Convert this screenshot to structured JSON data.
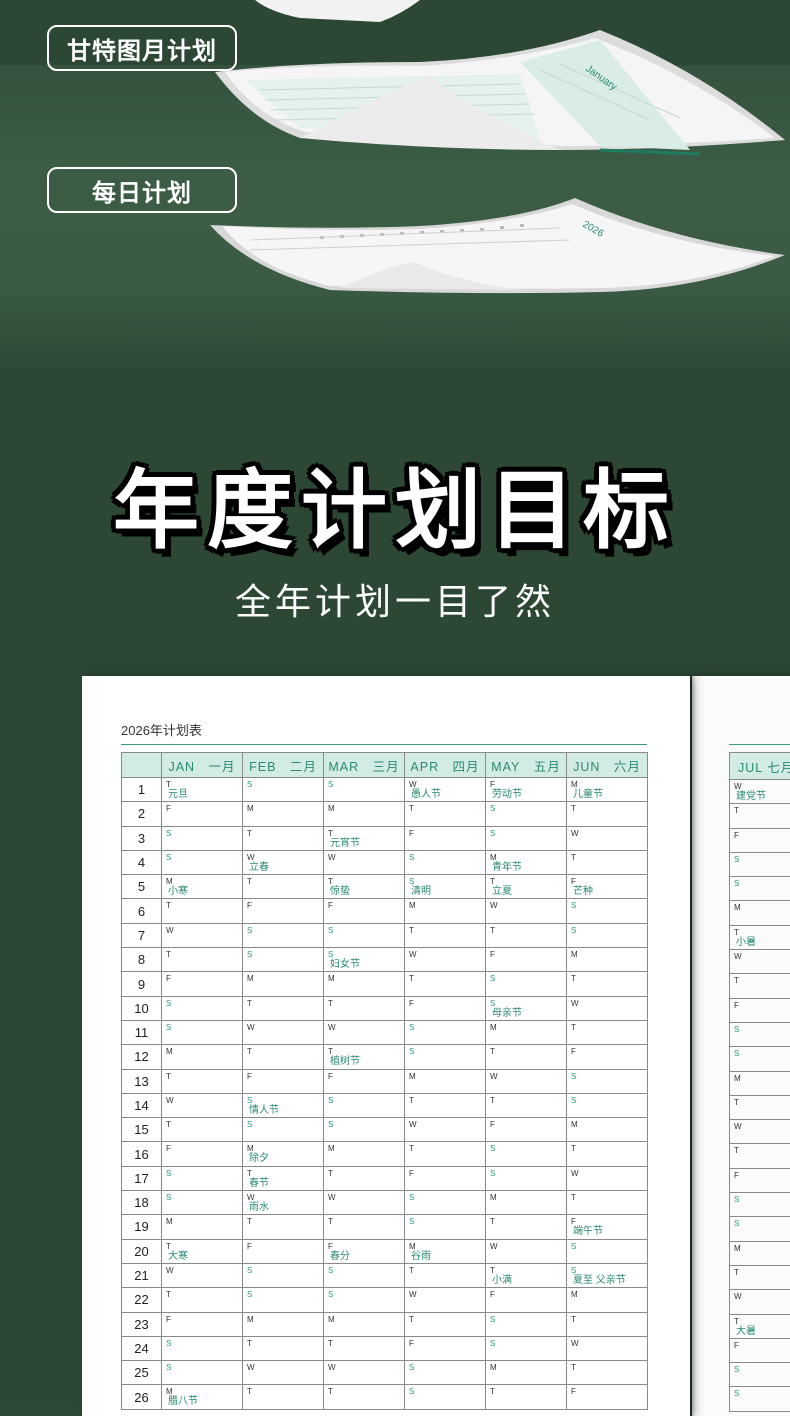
{
  "hero": {
    "gantt_label": "甘特图月计划",
    "daily_label": "每日计划",
    "sheet_month_label": "January",
    "sheet_year_label": "2026"
  },
  "section": {
    "title": "年度计划目标",
    "subtitle": "全年计划一目了然"
  },
  "sheet": {
    "heading": "2026年计划表",
    "months": [
      {
        "en": "JAN",
        "cn": "一月"
      },
      {
        "en": "FEB",
        "cn": "二月"
      },
      {
        "en": "MAR",
        "cn": "三月"
      },
      {
        "en": "APR",
        "cn": "四月"
      },
      {
        "en": "MAY",
        "cn": "五月"
      },
      {
        "en": "JUN",
        "cn": "六月"
      }
    ],
    "rows": [
      {
        "day": "1",
        "cells": [
          [
            "T",
            "元旦"
          ],
          [
            "S",
            ""
          ],
          [
            "S",
            ""
          ],
          [
            "W",
            "愚人节"
          ],
          [
            "F",
            "劳动节"
          ],
          [
            "M",
            "儿童节"
          ]
        ]
      },
      {
        "day": "2",
        "cells": [
          [
            "F",
            ""
          ],
          [
            "M",
            ""
          ],
          [
            "M",
            ""
          ],
          [
            "T",
            ""
          ],
          [
            "S",
            ""
          ],
          [
            "T",
            ""
          ]
        ]
      },
      {
        "day": "3",
        "cells": [
          [
            "S",
            ""
          ],
          [
            "T",
            ""
          ],
          [
            "T",
            "元宵节"
          ],
          [
            "F",
            ""
          ],
          [
            "S",
            ""
          ],
          [
            "W",
            ""
          ]
        ]
      },
      {
        "day": "4",
        "cells": [
          [
            "S",
            ""
          ],
          [
            "W",
            "立春"
          ],
          [
            "W",
            ""
          ],
          [
            "S",
            ""
          ],
          [
            "M",
            "青年节"
          ],
          [
            "T",
            ""
          ]
        ]
      },
      {
        "day": "5",
        "cells": [
          [
            "M",
            "小寒"
          ],
          [
            "T",
            ""
          ],
          [
            "T",
            "惊蛰"
          ],
          [
            "S",
            "清明"
          ],
          [
            "T",
            "立夏"
          ],
          [
            "F",
            "芒种"
          ]
        ]
      },
      {
        "day": "6",
        "cells": [
          [
            "T",
            ""
          ],
          [
            "F",
            ""
          ],
          [
            "F",
            ""
          ],
          [
            "M",
            ""
          ],
          [
            "W",
            ""
          ],
          [
            "S",
            ""
          ]
        ]
      },
      {
        "day": "7",
        "cells": [
          [
            "W",
            ""
          ],
          [
            "S",
            ""
          ],
          [
            "S",
            ""
          ],
          [
            "T",
            ""
          ],
          [
            "T",
            ""
          ],
          [
            "S",
            ""
          ]
        ]
      },
      {
        "day": "8",
        "cells": [
          [
            "T",
            ""
          ],
          [
            "S",
            ""
          ],
          [
            "S",
            "妇女节"
          ],
          [
            "W",
            ""
          ],
          [
            "F",
            ""
          ],
          [
            "M",
            ""
          ]
        ]
      },
      {
        "day": "9",
        "cells": [
          [
            "F",
            ""
          ],
          [
            "M",
            ""
          ],
          [
            "M",
            ""
          ],
          [
            "T",
            ""
          ],
          [
            "S",
            ""
          ],
          [
            "T",
            ""
          ]
        ]
      },
      {
        "day": "10",
        "cells": [
          [
            "S",
            ""
          ],
          [
            "T",
            ""
          ],
          [
            "T",
            ""
          ],
          [
            "F",
            ""
          ],
          [
            "S",
            "母亲节"
          ],
          [
            "W",
            ""
          ]
        ]
      },
      {
        "day": "11",
        "cells": [
          [
            "S",
            ""
          ],
          [
            "W",
            ""
          ],
          [
            "W",
            ""
          ],
          [
            "S",
            ""
          ],
          [
            "M",
            ""
          ],
          [
            "T",
            ""
          ]
        ]
      },
      {
        "day": "12",
        "cells": [
          [
            "M",
            ""
          ],
          [
            "T",
            ""
          ],
          [
            "T",
            "植树节"
          ],
          [
            "S",
            ""
          ],
          [
            "T",
            ""
          ],
          [
            "F",
            ""
          ]
        ]
      },
      {
        "day": "13",
        "cells": [
          [
            "T",
            ""
          ],
          [
            "F",
            ""
          ],
          [
            "F",
            ""
          ],
          [
            "M",
            ""
          ],
          [
            "W",
            ""
          ],
          [
            "S",
            ""
          ]
        ]
      },
      {
        "day": "14",
        "cells": [
          [
            "W",
            ""
          ],
          [
            "S",
            "情人节"
          ],
          [
            "S",
            ""
          ],
          [
            "T",
            ""
          ],
          [
            "T",
            ""
          ],
          [
            "S",
            ""
          ]
        ]
      },
      {
        "day": "15",
        "cells": [
          [
            "T",
            ""
          ],
          [
            "S",
            ""
          ],
          [
            "S",
            ""
          ],
          [
            "W",
            ""
          ],
          [
            "F",
            ""
          ],
          [
            "M",
            ""
          ]
        ]
      },
      {
        "day": "16",
        "cells": [
          [
            "F",
            ""
          ],
          [
            "M",
            "除夕"
          ],
          [
            "M",
            ""
          ],
          [
            "T",
            ""
          ],
          [
            "S",
            ""
          ],
          [
            "T",
            ""
          ]
        ]
      },
      {
        "day": "17",
        "cells": [
          [
            "S",
            ""
          ],
          [
            "T",
            "春节"
          ],
          [
            "T",
            ""
          ],
          [
            "F",
            ""
          ],
          [
            "S",
            ""
          ],
          [
            "W",
            ""
          ]
        ]
      },
      {
        "day": "18",
        "cells": [
          [
            "S",
            ""
          ],
          [
            "W",
            "雨水"
          ],
          [
            "W",
            ""
          ],
          [
            "S",
            ""
          ],
          [
            "M",
            ""
          ],
          [
            "T",
            ""
          ]
        ]
      },
      {
        "day": "19",
        "cells": [
          [
            "M",
            ""
          ],
          [
            "T",
            ""
          ],
          [
            "T",
            ""
          ],
          [
            "S",
            ""
          ],
          [
            "T",
            ""
          ],
          [
            "F",
            "端午节"
          ]
        ]
      },
      {
        "day": "20",
        "cells": [
          [
            "T",
            "大寒"
          ],
          [
            "F",
            ""
          ],
          [
            "F",
            "春分"
          ],
          [
            "M",
            "谷雨"
          ],
          [
            "W",
            ""
          ],
          [
            "S",
            ""
          ]
        ]
      },
      {
        "day": "21",
        "cells": [
          [
            "W",
            ""
          ],
          [
            "S",
            ""
          ],
          [
            "S",
            ""
          ],
          [
            "T",
            ""
          ],
          [
            "T",
            "小满"
          ],
          [
            "S",
            "夏至  父亲节"
          ]
        ]
      },
      {
        "day": "22",
        "cells": [
          [
            "T",
            ""
          ],
          [
            "S",
            ""
          ],
          [
            "S",
            ""
          ],
          [
            "W",
            ""
          ],
          [
            "F",
            ""
          ],
          [
            "M",
            ""
          ]
        ]
      },
      {
        "day": "23",
        "cells": [
          [
            "F",
            ""
          ],
          [
            "M",
            ""
          ],
          [
            "M",
            ""
          ],
          [
            "T",
            ""
          ],
          [
            "S",
            ""
          ],
          [
            "T",
            ""
          ]
        ]
      },
      {
        "day": "24",
        "cells": [
          [
            "S",
            ""
          ],
          [
            "T",
            ""
          ],
          [
            "T",
            ""
          ],
          [
            "F",
            ""
          ],
          [
            "S",
            ""
          ],
          [
            "W",
            ""
          ]
        ]
      },
      {
        "day": "25",
        "cells": [
          [
            "S",
            ""
          ],
          [
            "W",
            ""
          ],
          [
            "W",
            ""
          ],
          [
            "S",
            ""
          ],
          [
            "M",
            ""
          ],
          [
            "T",
            ""
          ]
        ]
      },
      {
        "day": "26",
        "cells": [
          [
            "M",
            "腊八节"
          ],
          [
            "T",
            ""
          ],
          [
            "T",
            ""
          ],
          [
            "S",
            ""
          ],
          [
            "T",
            ""
          ],
          [
            "F",
            ""
          ]
        ]
      }
    ],
    "next_month": {
      "en": "JUL",
      "cn": "七月"
    },
    "next_cells": [
      [
        "W",
        "建党节"
      ],
      [
        "T",
        ""
      ],
      [
        "F",
        ""
      ],
      [
        "S",
        ""
      ],
      [
        "S",
        ""
      ],
      [
        "M",
        ""
      ],
      [
        "T",
        "小暑"
      ],
      [
        "W",
        ""
      ],
      [
        "T",
        ""
      ],
      [
        "F",
        ""
      ],
      [
        "S",
        ""
      ],
      [
        "S",
        ""
      ],
      [
        "M",
        ""
      ],
      [
        "T",
        ""
      ],
      [
        "W",
        ""
      ],
      [
        "T",
        ""
      ],
      [
        "F",
        ""
      ],
      [
        "S",
        ""
      ],
      [
        "S",
        ""
      ],
      [
        "M",
        ""
      ],
      [
        "T",
        ""
      ],
      [
        "W",
        ""
      ],
      [
        "T",
        "大暑"
      ],
      [
        "F",
        ""
      ],
      [
        "S",
        ""
      ],
      [
        "S",
        ""
      ]
    ]
  },
  "colors": {
    "background": "#2d4735",
    "accent_green": "#2a8a73",
    "header_fill": "#d3ebe5"
  }
}
